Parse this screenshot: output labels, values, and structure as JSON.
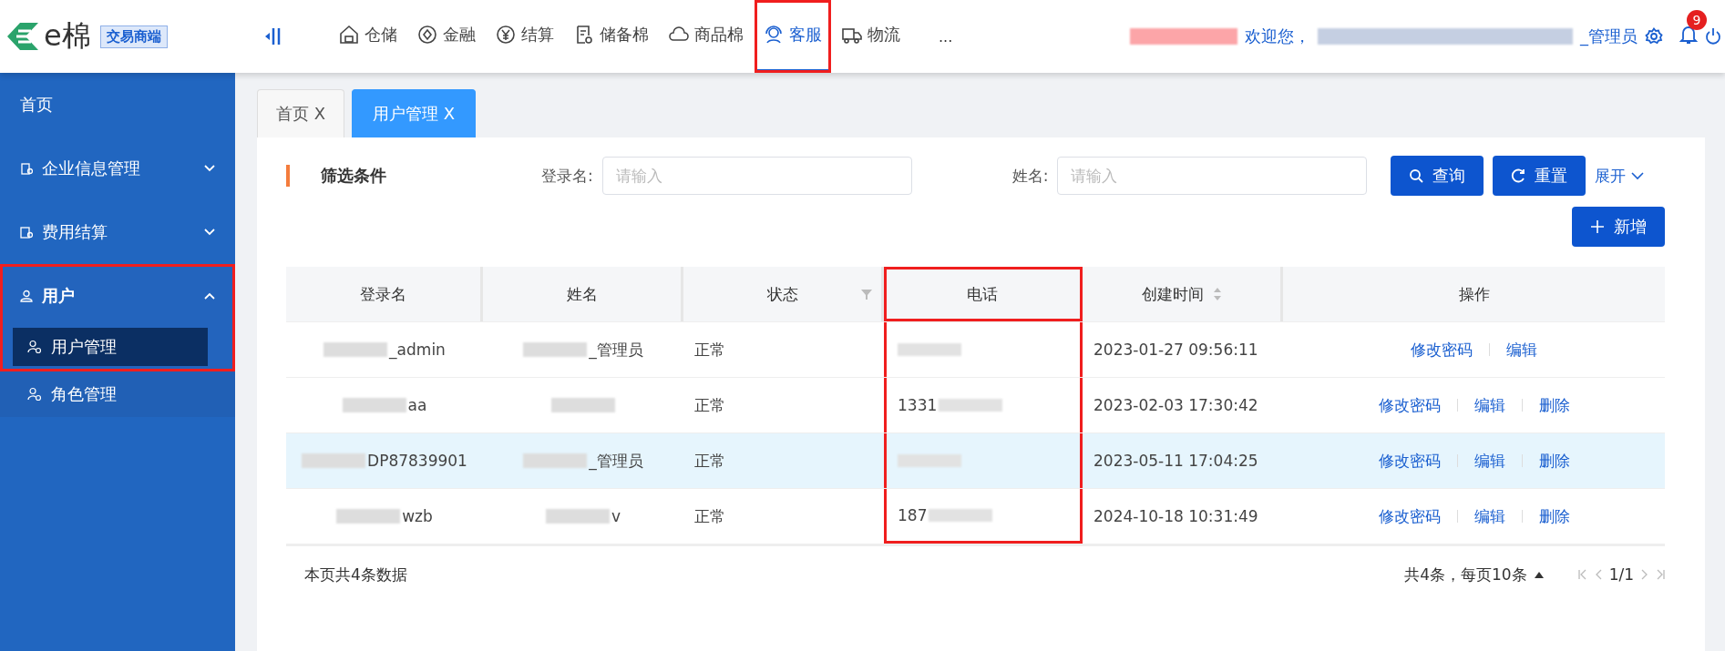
{
  "header": {
    "logo_text": "e棉",
    "logo_badge": "交易商端",
    "nav": [
      {
        "label": "仓储",
        "kind": "warehouse",
        "selected": false,
        "highlighted": false
      },
      {
        "label": "金融",
        "kind": "finance",
        "selected": false,
        "highlighted": false
      },
      {
        "label": "结算",
        "kind": "yen",
        "selected": false,
        "highlighted": false
      },
      {
        "label": "储备棉",
        "kind": "doc",
        "selected": false,
        "highlighted": false
      },
      {
        "label": "商品棉",
        "kind": "cloud",
        "selected": false,
        "highlighted": false
      },
      {
        "label": "客服",
        "kind": "service",
        "selected": true,
        "highlighted": true
      },
      {
        "label": "物流",
        "kind": "truck",
        "selected": false,
        "highlighted": false
      }
    ],
    "more": "...",
    "welcome": "欢迎您，",
    "user_role": "_管理员",
    "notifications": "9"
  },
  "sidebar": {
    "items": [
      {
        "label": "首页",
        "kind": "plain",
        "expanded": false,
        "highlighted": false
      },
      {
        "label": "企业信息管理",
        "kind": "building",
        "expanded": false,
        "highlighted": false
      },
      {
        "label": "费用结算",
        "kind": "bill",
        "expanded": false,
        "highlighted": false
      },
      {
        "label": "用户",
        "kind": "user",
        "expanded": true,
        "highlighted": true,
        "children": [
          {
            "label": "用户管理",
            "selected": true
          },
          {
            "label": "角色管理",
            "selected": false
          }
        ]
      }
    ]
  },
  "tabs": [
    {
      "label": "首页",
      "close": "X",
      "selected": false
    },
    {
      "label": "用户管理",
      "close": "X",
      "selected": true
    }
  ],
  "filter": {
    "title": "筛选条件",
    "fields": [
      {
        "label": "登录名:",
        "placeholder": "请输入"
      },
      {
        "label": "姓名:",
        "placeholder": "请输入"
      }
    ],
    "search_button": "查询",
    "reset_button": "重置",
    "expand_link": "展开"
  },
  "add_button": "新增",
  "table": {
    "columns": [
      {
        "label": "登录名",
        "sort": false,
        "filter": false,
        "highlighted": false
      },
      {
        "label": "姓名",
        "sort": false,
        "filter": false,
        "highlighted": false
      },
      {
        "label": "状态",
        "sort": false,
        "filter": true,
        "highlighted": false
      },
      {
        "label": "电话",
        "sort": false,
        "filter": false,
        "highlighted": true
      },
      {
        "label": "创建时间",
        "sort": true,
        "filter": false,
        "highlighted": false
      },
      {
        "label": "操作",
        "sort": false,
        "filter": false,
        "highlighted": false
      }
    ],
    "rows": [
      {
        "selected": false,
        "login": "_admin",
        "name": "_管理员",
        "status": "正常",
        "created": "2023-01-27 09:56:11",
        "actions": [
          "修改密码",
          "编辑"
        ]
      },
      {
        "selected": false,
        "login": "aa",
        "status": "正常",
        "phone": "1331",
        "created": "2023-02-03 17:30:42",
        "actions": [
          "修改密码",
          "编辑",
          "删除"
        ]
      },
      {
        "selected": true,
        "login": "DP87839901",
        "name": "_管理员",
        "status": "正常",
        "created": "2023-05-11 17:04:25",
        "actions": [
          "修改密码",
          "编辑",
          "删除"
        ]
      },
      {
        "selected": false,
        "login": "wzb",
        "name": "v",
        "status": "正常",
        "phone": "187",
        "created": "2024-10-18 10:31:49",
        "actions": [
          "修改密码",
          "编辑",
          "删除"
        ]
      }
    ]
  },
  "footer": {
    "summary": "本页共4条数据",
    "total": "共4条，每页10条",
    "page": "1/1"
  }
}
